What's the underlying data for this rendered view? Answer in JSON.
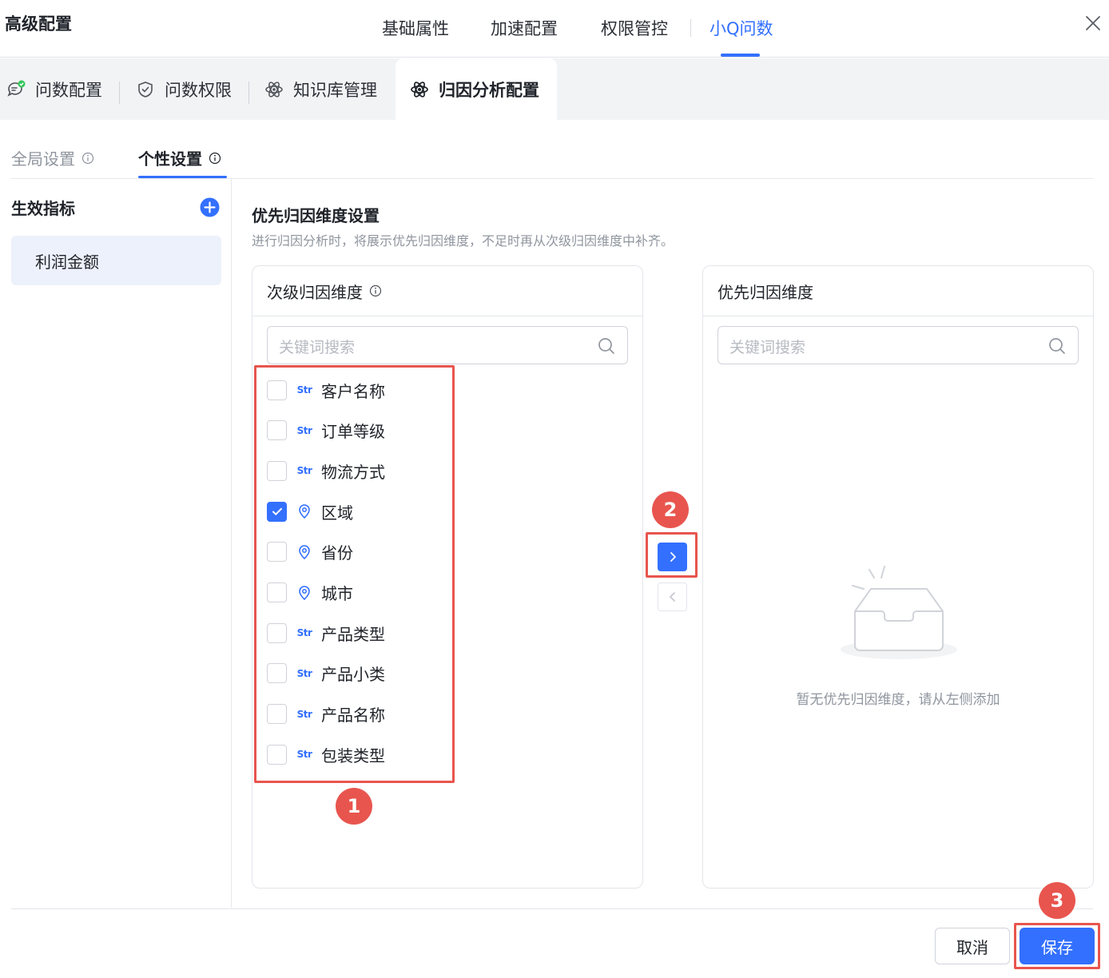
{
  "header": {
    "title": "高级配置",
    "tabs": [
      {
        "label": "基础属性"
      },
      {
        "label": "加速配置"
      },
      {
        "label": "权限管控"
      },
      {
        "label": "小Q问数"
      }
    ],
    "active_tab": "小Q问数"
  },
  "subtabs": [
    {
      "label": "问数配置",
      "icon": "chat-bubble-check-icon"
    },
    {
      "label": "问数权限",
      "icon": "shield-check-icon"
    },
    {
      "label": "知识库管理",
      "icon": "atom-icon"
    },
    {
      "label": "归因分析配置",
      "icon": "atom-icon"
    }
  ],
  "level3_tabs": [
    {
      "label": "全局设置"
    },
    {
      "label": "个性设置"
    }
  ],
  "sidebar": {
    "title": "生效指标",
    "items": [
      {
        "label": "利润金额"
      }
    ]
  },
  "section": {
    "title": "优先归因维度设置",
    "description": "进行归因分析时，将展示优先归因维度，不足时再从次级归因维度中补齐。"
  },
  "left_panel": {
    "title": "次级归因维度",
    "search_placeholder": "关键词搜索",
    "items": [
      {
        "label": "客户名称",
        "type": "Str",
        "checked": false
      },
      {
        "label": "订单等级",
        "type": "Str",
        "checked": false
      },
      {
        "label": "物流方式",
        "type": "Str",
        "checked": false
      },
      {
        "label": "区域",
        "type": "geo",
        "checked": true
      },
      {
        "label": "省份",
        "type": "geo",
        "checked": false
      },
      {
        "label": "城市",
        "type": "geo",
        "checked": false
      },
      {
        "label": "产品类型",
        "type": "Str",
        "checked": false
      },
      {
        "label": "产品小类",
        "type": "Str",
        "checked": false
      },
      {
        "label": "产品名称",
        "type": "Str",
        "checked": false
      },
      {
        "label": "包装类型",
        "type": "Str",
        "checked": false
      }
    ]
  },
  "right_panel": {
    "title": "优先归因维度",
    "search_placeholder": "关键词搜索",
    "empty_text": "暂无优先归因维度，请从左侧添加"
  },
  "annotations": {
    "step1": "1",
    "step2": "2",
    "step3": "3"
  },
  "footer": {
    "cancel_label": "取消",
    "save_label": "保存"
  },
  "colors": {
    "accent": "#3370ff",
    "highlight": "#e8554e"
  }
}
